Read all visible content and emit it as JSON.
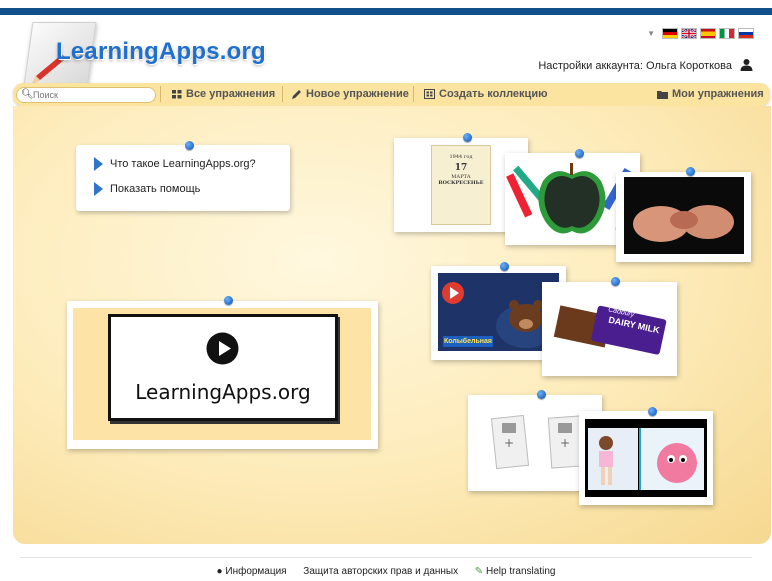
{
  "header": {
    "logo_text": "LearningApps.org",
    "account_label": "Настройки аккаунта: Ольга Короткова",
    "languages": [
      "de-flag-icon",
      "uk-flag-icon",
      "es-flag-icon",
      "it-flag-icon",
      "ru-flag-icon"
    ]
  },
  "nav": {
    "search_placeholder": "Поиск",
    "all_exercises": "Все упражнения",
    "new_exercise": "Новое упражнение",
    "create_collection": "Создать коллекцию",
    "my_exercises": "Мои упражнения"
  },
  "help": {
    "what_is": "Что такое LearningApps.org?",
    "show_help": "Показать помощь"
  },
  "video": {
    "caption": "LearningApps.org"
  },
  "thumbs": {
    "calendar_line1": "1944 год",
    "calendar_day": "17",
    "calendar_month": "МАРТА",
    "calendar_weekday": "ВОСКРЕСЕНЬЕ",
    "cartoon_title": "Колыбельная",
    "chocolate_brand": "Cadbury",
    "chocolate_name": "DAIRY MILK"
  },
  "footer": {
    "info": "Информация",
    "copyright": "Защита авторских прав и данных",
    "help_translating": "Help translating"
  },
  "colors": {
    "brand_blue": "#1f6fd1",
    "top_bar": "#12508c",
    "nav_bg": "#fbe3a0",
    "board": "#fdebb9"
  }
}
